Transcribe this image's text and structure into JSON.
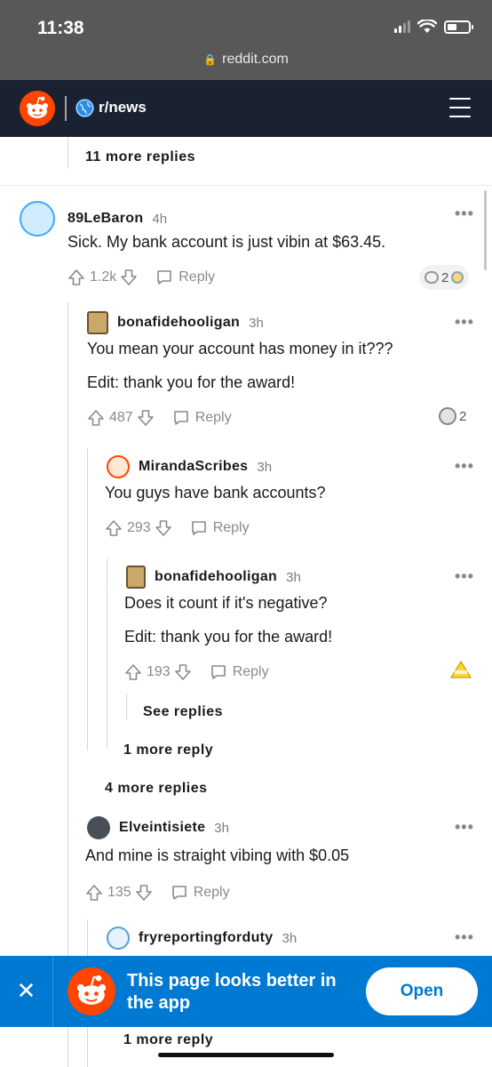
{
  "status_bar": {
    "time": "11:38",
    "url": "reddit.com"
  },
  "header": {
    "subreddit": "r/news"
  },
  "thread": {
    "top_more": "11 more replies",
    "comments": [
      {
        "username": "89LeBaron",
        "age": "4h",
        "text": [
          "Sick. My bank account is just vibin at $63.45."
        ],
        "score": "1.2k",
        "reply": "Reply",
        "award_count": "2"
      },
      {
        "username": "bonafidehooligan",
        "age": "3h",
        "text": [
          "You mean your account has money in it???",
          "Edit: thank you for the award!"
        ],
        "score": "487",
        "reply": "Reply",
        "award_count": "2"
      },
      {
        "username": "MirandaScribes",
        "age": "3h",
        "text": [
          "You guys have bank accounts?"
        ],
        "score": "293",
        "reply": "Reply"
      },
      {
        "username": "bonafidehooligan",
        "age": "3h",
        "text": [
          "Does it count if it's negative?",
          "Edit: thank you for the award!"
        ],
        "score": "193",
        "reply": "Reply"
      },
      {
        "username": "Elveintisiete",
        "age": "3h",
        "text": [
          "And mine is straight vibing with $0.05"
        ],
        "score": "135",
        "reply": "Reply"
      },
      {
        "username": "fryreportingforduty",
        "age": "3h"
      }
    ],
    "see_replies": "See replies",
    "more_1": "1 more reply",
    "more_4": "4 more replies",
    "more_bottom": "1 more reply"
  },
  "banner": {
    "close": "✕",
    "text": "This page looks better in the app",
    "open": "Open"
  },
  "colors": {
    "reddit_orange": "#ff4500",
    "banner_blue": "#0079d3",
    "header_dark": "#1a2130"
  }
}
